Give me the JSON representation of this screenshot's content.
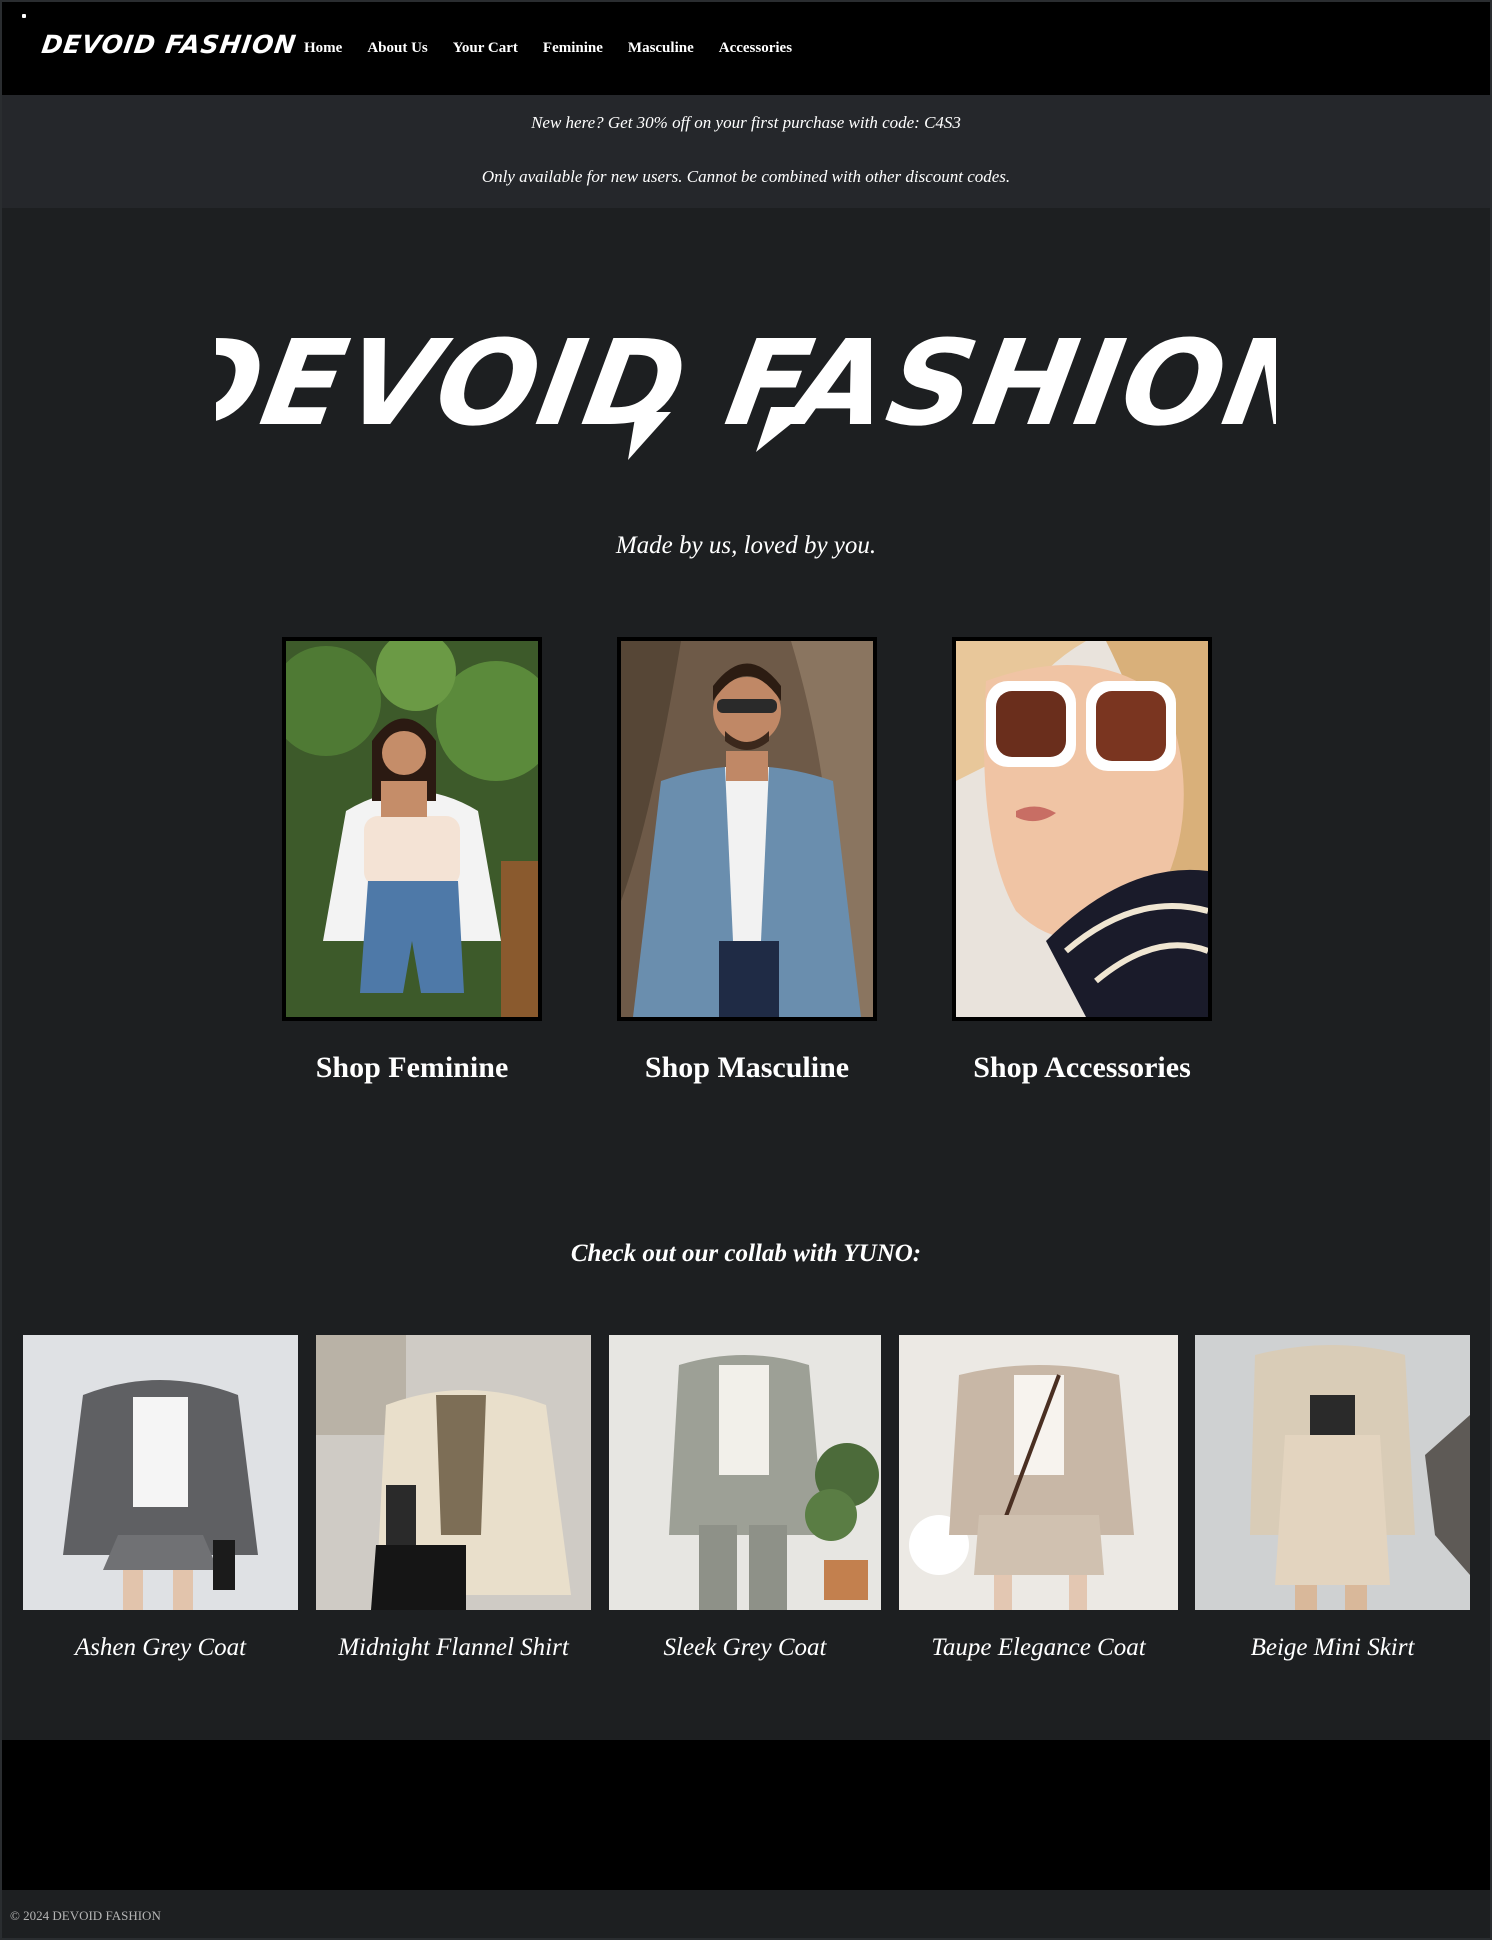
{
  "nav": {
    "brand": "DEVOID FASHION",
    "links": [
      "Home",
      "About Us",
      "Your Cart",
      "Feminine",
      "Masculine",
      "Accessories"
    ]
  },
  "promo": {
    "line1": "New here? Get 30% off on your first purchase with code: C4S3",
    "line2": "Only available for new users. Cannot be combined with other discount codes."
  },
  "hero": {
    "logo_text": "DEVOID FASHION",
    "tagline": "Made by us, loved by you."
  },
  "categories": [
    {
      "label": "Shop Feminine",
      "icon": "photo-woman-white-shirt"
    },
    {
      "label": "Shop Masculine",
      "icon": "photo-man-blue-blazer"
    },
    {
      "label": "Shop Accessories",
      "icon": "photo-woman-sunglasses-scarf"
    }
  ],
  "collab": {
    "heading": "Check out our collab with YUNO:",
    "products": [
      {
        "name": "Ashen Grey Coat"
      },
      {
        "name": "Midnight Flannel Shirt"
      },
      {
        "name": "Sleek Grey Coat"
      },
      {
        "name": "Taupe Elegance Coat"
      },
      {
        "name": "Beige Mini Skirt"
      }
    ]
  },
  "footer": {
    "copyright": "© 2024 DEVOID FASHION"
  },
  "colors": {
    "background": "#1d1f21",
    "navbar": "#000000",
    "promo": "#25272b",
    "text": "#ffffff"
  }
}
